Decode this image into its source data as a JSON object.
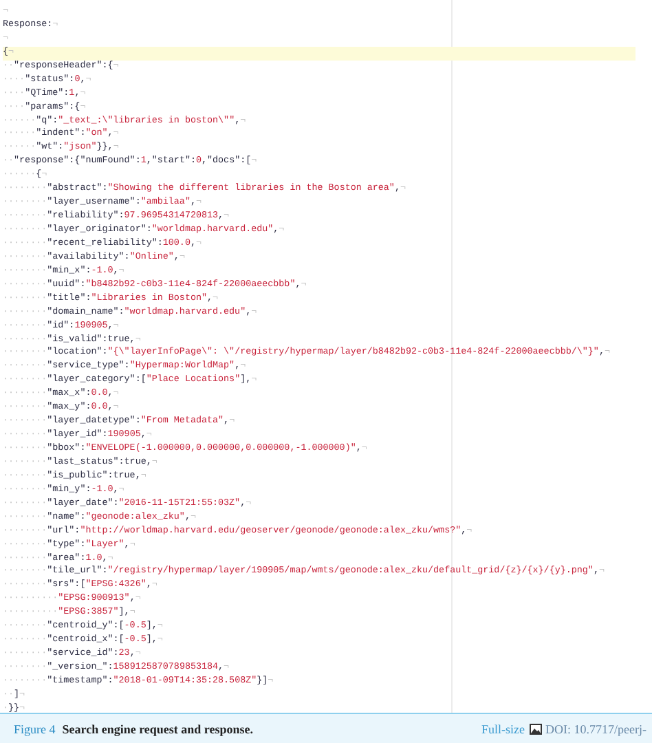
{
  "editor": {
    "lines": [
      {
        "current": false,
        "end": "¬"
      },
      {
        "current": false,
        "parts": [
          {
            "kind": "plain",
            "text": "Response:"
          }
        ],
        "end": "¬"
      },
      {
        "current": false,
        "end": "¬"
      },
      {
        "current": true,
        "parts": [
          {
            "kind": "plain",
            "text": "{"
          }
        ],
        "end": "¬"
      },
      {
        "current": false,
        "indent": "··",
        "parts": [
          {
            "kind": "plain",
            "text": "\"responseHeader\":{"
          }
        ],
        "end": "¬"
      },
      {
        "current": false,
        "indent": "····",
        "parts": [
          {
            "kind": "plain",
            "text": "\"status\":"
          },
          {
            "kind": "value",
            "text": "0"
          },
          {
            "kind": "plain",
            "text": ","
          }
        ],
        "end": "¬"
      },
      {
        "current": false,
        "indent": "····",
        "parts": [
          {
            "kind": "plain",
            "text": "\"QTime\":"
          },
          {
            "kind": "value",
            "text": "1"
          },
          {
            "kind": "plain",
            "text": ","
          }
        ],
        "end": "¬"
      },
      {
        "current": false,
        "indent": "····",
        "parts": [
          {
            "kind": "plain",
            "text": "\"params\":{"
          }
        ],
        "end": "¬"
      },
      {
        "current": false,
        "indent": "······",
        "parts": [
          {
            "kind": "plain",
            "text": "\"q\":"
          },
          {
            "kind": "value",
            "text": "\"_text_:\\\"libraries in boston\\\"\""
          },
          {
            "kind": "plain",
            "text": ","
          }
        ],
        "end": "¬"
      },
      {
        "current": false,
        "indent": "······",
        "parts": [
          {
            "kind": "plain",
            "text": "\"indent\":"
          },
          {
            "kind": "value",
            "text": "\"on\""
          },
          {
            "kind": "plain",
            "text": ","
          }
        ],
        "end": "¬"
      },
      {
        "current": false,
        "indent": "······",
        "parts": [
          {
            "kind": "plain",
            "text": "\"wt\":"
          },
          {
            "kind": "value",
            "text": "\"json\""
          },
          {
            "kind": "plain",
            "text": "}},"
          }
        ],
        "end": "¬"
      },
      {
        "current": false,
        "indent": "··",
        "parts": [
          {
            "kind": "plain",
            "text": "\"response\":{\"numFound\":"
          },
          {
            "kind": "value",
            "text": "1"
          },
          {
            "kind": "plain",
            "text": ",\"start\":"
          },
          {
            "kind": "value",
            "text": "0"
          },
          {
            "kind": "plain",
            "text": ",\"docs\":["
          }
        ],
        "end": "¬"
      },
      {
        "current": false,
        "indent": "······",
        "parts": [
          {
            "kind": "plain",
            "text": "{"
          }
        ],
        "end": "¬"
      },
      {
        "current": false,
        "indent": "········",
        "parts": [
          {
            "kind": "plain",
            "text": "\"abstract\":"
          },
          {
            "kind": "value",
            "text": "\"Showing the different libraries in the Boston area\""
          },
          {
            "kind": "plain",
            "text": ","
          }
        ],
        "end": "¬"
      },
      {
        "current": false,
        "indent": "········",
        "parts": [
          {
            "kind": "plain",
            "text": "\"layer_username\":"
          },
          {
            "kind": "value",
            "text": "\"ambilaa\""
          },
          {
            "kind": "plain",
            "text": ","
          }
        ],
        "end": "¬"
      },
      {
        "current": false,
        "indent": "········",
        "parts": [
          {
            "kind": "plain",
            "text": "\"reliability\":"
          },
          {
            "kind": "value",
            "text": "97.96954314720813"
          },
          {
            "kind": "plain",
            "text": ","
          }
        ],
        "end": "¬"
      },
      {
        "current": false,
        "indent": "········",
        "parts": [
          {
            "kind": "plain",
            "text": "\"layer_originator\":"
          },
          {
            "kind": "value",
            "text": "\"worldmap.harvard.edu\""
          },
          {
            "kind": "plain",
            "text": ","
          }
        ],
        "end": "¬"
      },
      {
        "current": false,
        "indent": "········",
        "parts": [
          {
            "kind": "plain",
            "text": "\"recent_reliability\":"
          },
          {
            "kind": "value",
            "text": "100.0"
          },
          {
            "kind": "plain",
            "text": ","
          }
        ],
        "end": "¬"
      },
      {
        "current": false,
        "indent": "········",
        "parts": [
          {
            "kind": "plain",
            "text": "\"availability\":"
          },
          {
            "kind": "value",
            "text": "\"Online\""
          },
          {
            "kind": "plain",
            "text": ","
          }
        ],
        "end": "¬"
      },
      {
        "current": false,
        "indent": "········",
        "parts": [
          {
            "kind": "plain",
            "text": "\"min_x\":"
          },
          {
            "kind": "value",
            "text": "-1.0"
          },
          {
            "kind": "plain",
            "text": ","
          }
        ],
        "end": "¬"
      },
      {
        "current": false,
        "indent": "········",
        "parts": [
          {
            "kind": "plain",
            "text": "\"uuid\":"
          },
          {
            "kind": "value",
            "text": "\"b8482b92-c0b3-11e4-824f-22000aeecbbb\""
          },
          {
            "kind": "plain",
            "text": ","
          }
        ],
        "end": "¬"
      },
      {
        "current": false,
        "indent": "········",
        "parts": [
          {
            "kind": "plain",
            "text": "\"title\":"
          },
          {
            "kind": "value",
            "text": "\"Libraries in Boston\""
          },
          {
            "kind": "plain",
            "text": ","
          }
        ],
        "end": "¬"
      },
      {
        "current": false,
        "indent": "········",
        "parts": [
          {
            "kind": "plain",
            "text": "\"domain_name\":"
          },
          {
            "kind": "value",
            "text": "\"worldmap.harvard.edu\""
          },
          {
            "kind": "plain",
            "text": ","
          }
        ],
        "end": "¬"
      },
      {
        "current": false,
        "indent": "········",
        "parts": [
          {
            "kind": "plain",
            "text": "\"id\":"
          },
          {
            "kind": "value",
            "text": "190905"
          },
          {
            "kind": "plain",
            "text": ","
          }
        ],
        "end": "¬"
      },
      {
        "current": false,
        "indent": "········",
        "parts": [
          {
            "kind": "plain",
            "text": "\"is_valid\":true,"
          }
        ],
        "end": "¬"
      },
      {
        "current": false,
        "indent": "········",
        "parts": [
          {
            "kind": "plain",
            "text": "\"location\":"
          },
          {
            "kind": "value",
            "text": "\"{\\\"layerInfoPage\\\": \\\"/registry/hypermap/layer/b8482b92-c0b3-11e4-824f-22000aeecbbb/\\\"}\""
          },
          {
            "kind": "plain",
            "text": ","
          }
        ],
        "end": "¬"
      },
      {
        "current": false,
        "indent": "········",
        "parts": [
          {
            "kind": "plain",
            "text": "\"service_type\":"
          },
          {
            "kind": "value",
            "text": "\"Hypermap:WorldMap\""
          },
          {
            "kind": "plain",
            "text": ","
          }
        ],
        "end": "¬"
      },
      {
        "current": false,
        "indent": "········",
        "parts": [
          {
            "kind": "plain",
            "text": "\"layer_category\":["
          },
          {
            "kind": "value",
            "text": "\"Place Locations\""
          },
          {
            "kind": "plain",
            "text": "],"
          }
        ],
        "end": "¬"
      },
      {
        "current": false,
        "indent": "········",
        "parts": [
          {
            "kind": "plain",
            "text": "\"max_x\":"
          },
          {
            "kind": "value",
            "text": "0.0"
          },
          {
            "kind": "plain",
            "text": ","
          }
        ],
        "end": "¬"
      },
      {
        "current": false,
        "indent": "········",
        "parts": [
          {
            "kind": "plain",
            "text": "\"max_y\":"
          },
          {
            "kind": "value",
            "text": "0.0"
          },
          {
            "kind": "plain",
            "text": ","
          }
        ],
        "end": "¬"
      },
      {
        "current": false,
        "indent": "········",
        "parts": [
          {
            "kind": "plain",
            "text": "\"layer_datetype\":"
          },
          {
            "kind": "value",
            "text": "\"From Metadata\""
          },
          {
            "kind": "plain",
            "text": ","
          }
        ],
        "end": "¬"
      },
      {
        "current": false,
        "indent": "········",
        "parts": [
          {
            "kind": "plain",
            "text": "\"layer_id\":"
          },
          {
            "kind": "value",
            "text": "190905"
          },
          {
            "kind": "plain",
            "text": ","
          }
        ],
        "end": "¬"
      },
      {
        "current": false,
        "indent": "········",
        "parts": [
          {
            "kind": "plain",
            "text": "\"bbox\":"
          },
          {
            "kind": "value",
            "text": "\"ENVELOPE(-1.000000,0.000000,0.000000,-1.000000)\""
          },
          {
            "kind": "plain",
            "text": ","
          }
        ],
        "end": "¬"
      },
      {
        "current": false,
        "indent": "········",
        "parts": [
          {
            "kind": "plain",
            "text": "\"last_status\":true,"
          }
        ],
        "end": "¬"
      },
      {
        "current": false,
        "indent": "········",
        "parts": [
          {
            "kind": "plain",
            "text": "\"is_public\":true,"
          }
        ],
        "end": "¬"
      },
      {
        "current": false,
        "indent": "········",
        "parts": [
          {
            "kind": "plain",
            "text": "\"min_y\":"
          },
          {
            "kind": "value",
            "text": "-1.0"
          },
          {
            "kind": "plain",
            "text": ","
          }
        ],
        "end": "¬"
      },
      {
        "current": false,
        "indent": "········",
        "parts": [
          {
            "kind": "plain",
            "text": "\"layer_date\":"
          },
          {
            "kind": "value",
            "text": "\"2016-11-15T21:55:03Z\""
          },
          {
            "kind": "plain",
            "text": ","
          }
        ],
        "end": "¬"
      },
      {
        "current": false,
        "indent": "········",
        "parts": [
          {
            "kind": "plain",
            "text": "\"name\":"
          },
          {
            "kind": "value",
            "text": "\"geonode:alex_zku\""
          },
          {
            "kind": "plain",
            "text": ","
          }
        ],
        "end": "¬"
      },
      {
        "current": false,
        "indent": "········",
        "parts": [
          {
            "kind": "plain",
            "text": "\"url\":"
          },
          {
            "kind": "value",
            "text": "\"http://worldmap.harvard.edu/geoserver/geonode/geonode:alex_zku/wms?\""
          },
          {
            "kind": "plain",
            "text": ","
          }
        ],
        "end": "¬"
      },
      {
        "current": false,
        "indent": "········",
        "parts": [
          {
            "kind": "plain",
            "text": "\"type\":"
          },
          {
            "kind": "value",
            "text": "\"Layer\""
          },
          {
            "kind": "plain",
            "text": ","
          }
        ],
        "end": "¬"
      },
      {
        "current": false,
        "indent": "········",
        "parts": [
          {
            "kind": "plain",
            "text": "\"area\":"
          },
          {
            "kind": "value",
            "text": "1.0"
          },
          {
            "kind": "plain",
            "text": ","
          }
        ],
        "end": "¬"
      },
      {
        "current": false,
        "indent": "········",
        "parts": [
          {
            "kind": "plain",
            "text": "\"tile_url\":"
          },
          {
            "kind": "value",
            "text": "\"/registry/hypermap/layer/190905/map/wmts/geonode:alex_zku/default_grid/{z}/{x}/{y}.png\""
          },
          {
            "kind": "plain",
            "text": ","
          }
        ],
        "end": "¬"
      },
      {
        "current": false,
        "indent": "········",
        "parts": [
          {
            "kind": "plain",
            "text": "\"srs\":["
          },
          {
            "kind": "value",
            "text": "\"EPSG:4326\""
          },
          {
            "kind": "plain",
            "text": ","
          }
        ],
        "end": "¬"
      },
      {
        "current": false,
        "indent": "··········",
        "parts": [
          {
            "kind": "value",
            "text": "\"EPSG:900913\""
          },
          {
            "kind": "plain",
            "text": ","
          }
        ],
        "end": "¬"
      },
      {
        "current": false,
        "indent": "··········",
        "parts": [
          {
            "kind": "value",
            "text": "\"EPSG:3857\""
          },
          {
            "kind": "plain",
            "text": "],"
          }
        ],
        "end": "¬"
      },
      {
        "current": false,
        "indent": "········",
        "parts": [
          {
            "kind": "plain",
            "text": "\"centroid_y\":["
          },
          {
            "kind": "value",
            "text": "-0.5"
          },
          {
            "kind": "plain",
            "text": "],"
          }
        ],
        "end": "¬"
      },
      {
        "current": false,
        "indent": "········",
        "parts": [
          {
            "kind": "plain",
            "text": "\"centroid_x\":["
          },
          {
            "kind": "value",
            "text": "-0.5"
          },
          {
            "kind": "plain",
            "text": "],"
          }
        ],
        "end": "¬"
      },
      {
        "current": false,
        "indent": "········",
        "parts": [
          {
            "kind": "plain",
            "text": "\"service_id\":"
          },
          {
            "kind": "value",
            "text": "23"
          },
          {
            "kind": "plain",
            "text": ","
          }
        ],
        "end": "¬"
      },
      {
        "current": false,
        "indent": "········",
        "parts": [
          {
            "kind": "plain",
            "text": "\"_version_\":"
          },
          {
            "kind": "value",
            "text": "1589125870789853184"
          },
          {
            "kind": "plain",
            "text": ","
          }
        ],
        "end": "¬"
      },
      {
        "current": false,
        "indent": "········",
        "parts": [
          {
            "kind": "plain",
            "text": "\"timestamp\":"
          },
          {
            "kind": "value",
            "text": "\"2018-01-09T14:35:28.508Z\""
          },
          {
            "kind": "plain",
            "text": "}]"
          }
        ],
        "end": "¬"
      },
      {
        "current": false,
        "indent": "··",
        "parts": [
          {
            "kind": "plain",
            "text": "]"
          }
        ],
        "end": "¬"
      },
      {
        "current": false,
        "indent": "·",
        "parts": [
          {
            "kind": "plain",
            "text": "}}"
          }
        ],
        "end": "¬"
      }
    ]
  },
  "caption": {
    "figure_label": "Figure 4",
    "title": "Search engine request and response.",
    "full_size_link": "Full-size",
    "doi": "DOI: 10.7717/peerj-"
  }
}
